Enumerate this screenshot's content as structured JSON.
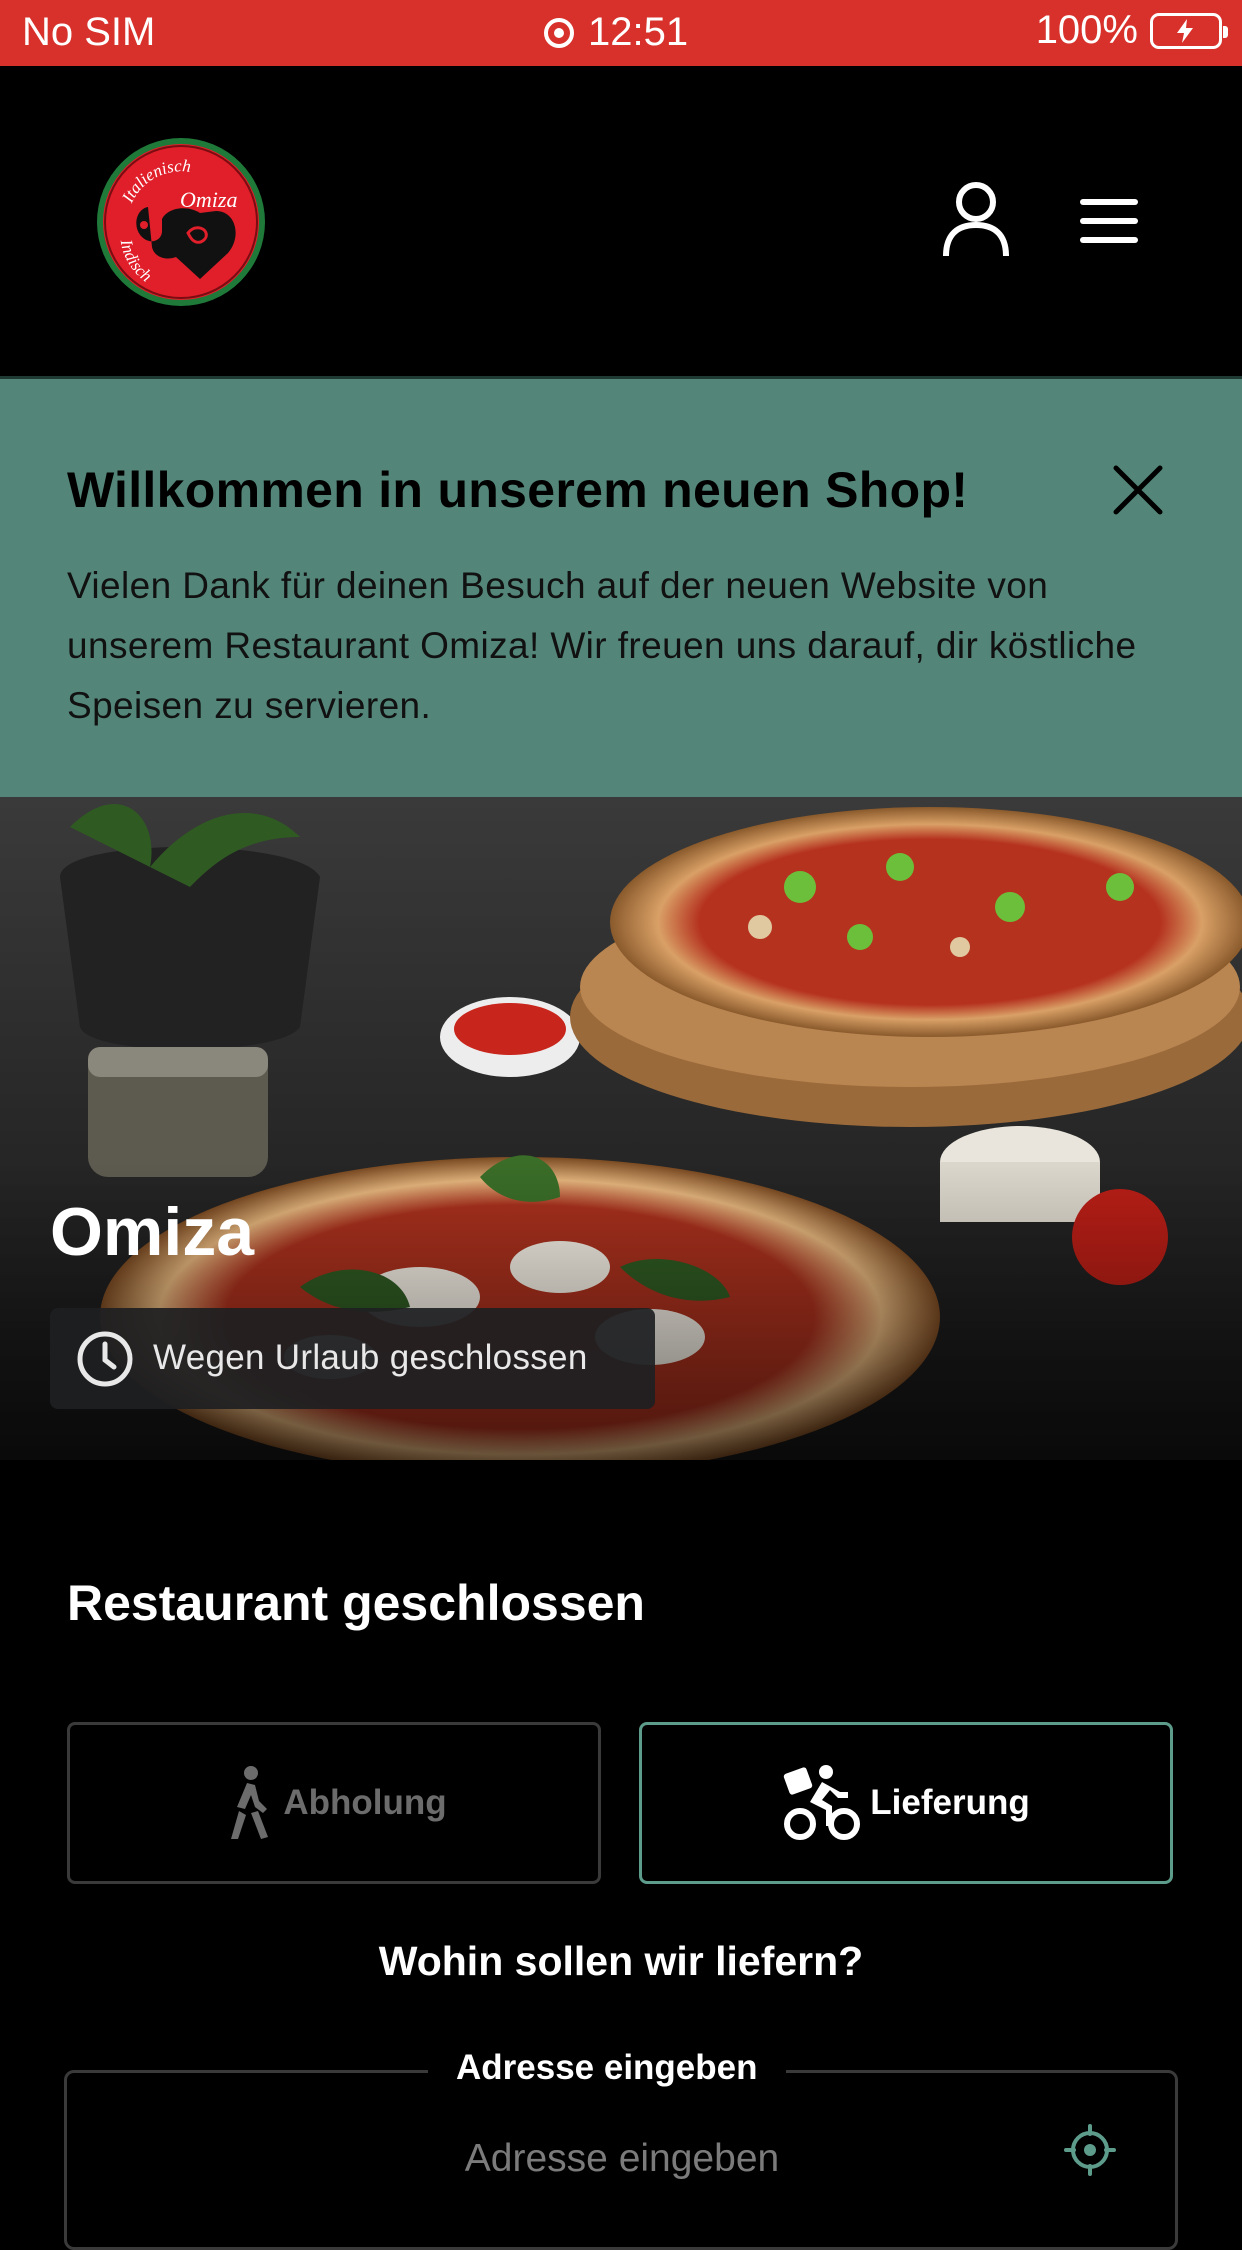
{
  "status_bar": {
    "carrier": "No SIM",
    "time": "12:51",
    "battery": "100%"
  },
  "header": {
    "logo": {
      "top_text": "Italienisch",
      "brand": "Omiza",
      "bottom_text": "Indisch"
    }
  },
  "banner": {
    "title": "Willkommen in unserem neuen Shop!",
    "text": "Vielen Dank für deinen Besuch auf der neuen Website von unserem Restaurant Omiza! Wir freuen uns darauf, dir köstliche Speisen zu servieren."
  },
  "hero": {
    "name": "Omiza",
    "status": "Wegen Urlaub geschlossen"
  },
  "order": {
    "title": "Restaurant geschlossen",
    "pickup_label": "Abholung",
    "delivery_label": "Lieferung",
    "delivery_question": "Wohin sollen wir liefern?",
    "address_legend": "Adresse eingeben",
    "address_placeholder": "Adresse eingeben"
  },
  "colors": {
    "status_bar": "#d8312b",
    "banner": "#538679",
    "accent_border": "#5d9b8b",
    "background": "#000000"
  }
}
